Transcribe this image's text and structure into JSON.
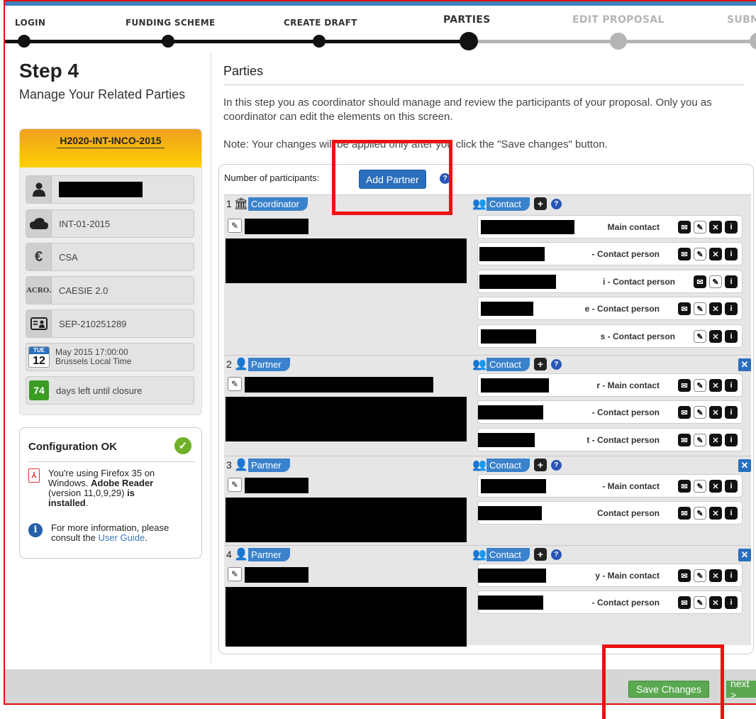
{
  "wizard": {
    "steps": [
      {
        "label": "LOGIN",
        "state": "done"
      },
      {
        "label": "FUNDING SCHEME",
        "state": "done"
      },
      {
        "label": "CREATE DRAFT",
        "state": "done"
      },
      {
        "label": "PARTIES",
        "state": "current"
      },
      {
        "label": "EDIT PROPOSAL",
        "state": "future"
      },
      {
        "label": "SUBMI",
        "state": "future"
      }
    ]
  },
  "sidebar": {
    "step_title": "Step 4",
    "step_subtitle": "Manage Your Related Parties",
    "call_id": "H2020-INT-INCO-2015",
    "topic": "INT-01-2015",
    "type": "CSA",
    "acronym_icon": "ACRO.",
    "acronym": "CAESIE 2.0",
    "proposal_id": "SEP-210251289",
    "deadline": {
      "cal_day": "TUE",
      "cal_date": "12",
      "line1": "May 2015 17:00:00",
      "line2": "Brussels Local Time"
    },
    "days_left": "74",
    "days_left_text": "days left until closure"
  },
  "config": {
    "title": "Configuration OK",
    "browser_line1": "You're using Firefox 35 on",
    "browser_line2": "Windows.",
    "reader_bold": "Adobe Reader",
    "reader_version": "(version 11,0,9,29)",
    "is_word": "is",
    "installed": "installed",
    "more_info": "For more information, please consult the",
    "guide_link": "User Guide",
    "period": "."
  },
  "main": {
    "title": "Parties",
    "intro": "In this step you as coordinator should manage and review the participants of your proposal. Only you as coordinator can edit the elements on this screen.",
    "note": "Note: Your changes will be applied only after you click the \"Save changes\" button.",
    "count_label": "Number of participants:",
    "add_partner": "Add Partner",
    "help": "?",
    "contact_tag": "Contact",
    "parties": [
      {
        "num": "1",
        "role": "Coordinator",
        "contacts": [
          "Main contact",
          "- Contact person",
          "i - Contact person",
          "e - Contact person",
          "s - Contact person"
        ]
      },
      {
        "num": "2",
        "role": "Partner",
        "contacts": [
          "r - Main contact",
          "- Contact person",
          "t - Contact person"
        ]
      },
      {
        "num": "3",
        "role": "Partner",
        "contacts": [
          "- Main contact",
          "Contact person"
        ]
      },
      {
        "num": "4",
        "role": "Partner",
        "contacts": [
          "y - Main contact",
          "- Contact person"
        ]
      }
    ]
  },
  "footer": {
    "save": "Save Changes",
    "next": "next >"
  },
  "colors": {
    "accent_blue": "#3a82cc",
    "save_green": "#5aa850",
    "highlight_red": "#ee1111",
    "call_header_orange": "#f0a020"
  }
}
